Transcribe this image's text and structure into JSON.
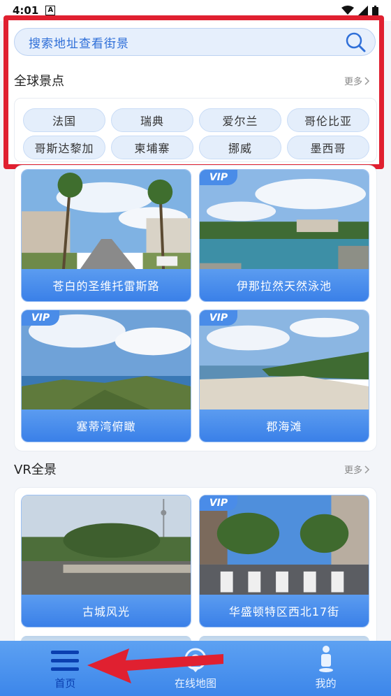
{
  "status_bar": {
    "time": "4:01",
    "indicator": "A"
  },
  "search": {
    "placeholder": "搜索地址查看街景",
    "icon": "search-icon"
  },
  "global_spots": {
    "title": "全球景点",
    "more_label": "更多",
    "chips": [
      "法国",
      "瑞典",
      "爱尔兰",
      "哥伦比亚",
      "哥斯达黎加",
      "柬埔寨",
      "挪威",
      "墨西哥"
    ]
  },
  "featured": [
    {
      "caption": "苍白的圣维托雷斯路",
      "vip": false,
      "scene": "palm-street"
    },
    {
      "caption": "伊那拉然天然泳池",
      "vip": true,
      "badge": "VIP",
      "scene": "lagoon"
    },
    {
      "caption": "塞蒂湾俯瞰",
      "vip": true,
      "badge": "VIP",
      "scene": "coast-overlook"
    },
    {
      "caption": "郡海滩",
      "vip": true,
      "badge": "VIP",
      "scene": "beach"
    }
  ],
  "vr": {
    "title": "VR全景",
    "more_label": "更多",
    "items": [
      {
        "caption": "古城风光",
        "vip": false,
        "scene": "old-town"
      },
      {
        "caption": "华盛顿特区西北17街",
        "vip": true,
        "badge": "VIP",
        "scene": "crosswalk"
      }
    ]
  },
  "tabs": [
    {
      "label": "首页",
      "icon": "menu-icon",
      "active": true
    },
    {
      "label": "在线地图",
      "icon": "map-pin-icon",
      "active": false
    },
    {
      "label": "我的",
      "icon": "person-icon",
      "active": false
    }
  ],
  "colors": {
    "accent": "#3c86ea",
    "highlight_box": "#e02030",
    "annotation_arrow": "#e02030"
  }
}
